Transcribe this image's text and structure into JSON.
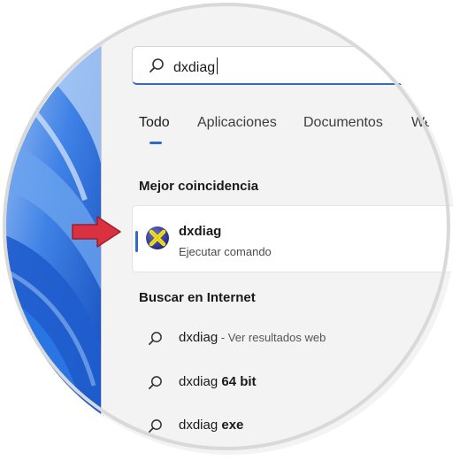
{
  "search": {
    "query": "dxdiag"
  },
  "tabs": [
    {
      "label": "Todo",
      "active": true
    },
    {
      "label": "Aplicaciones",
      "active": false
    },
    {
      "label": "Documentos",
      "active": false
    },
    {
      "label": "We",
      "active": false
    }
  ],
  "best_match": {
    "title": "Mejor coincidencia",
    "name": "dxdiag",
    "subtitle": "Ejecutar comando",
    "icon": "directx-icon"
  },
  "web": {
    "title": "Buscar en Internet",
    "results": [
      {
        "prefix": "dxdiag",
        "bold": "",
        "suffix": " - Ver resultados web"
      },
      {
        "prefix": "dxdiag ",
        "bold": "64 bit",
        "suffix": ""
      },
      {
        "prefix": "dxdiag ",
        "bold": "exe",
        "suffix": ""
      }
    ]
  },
  "colors": {
    "accent": "#2f6cc6",
    "arrow": "#d9313f",
    "panel": "#f3f3f3",
    "wallpaper": "#1d63d8"
  }
}
